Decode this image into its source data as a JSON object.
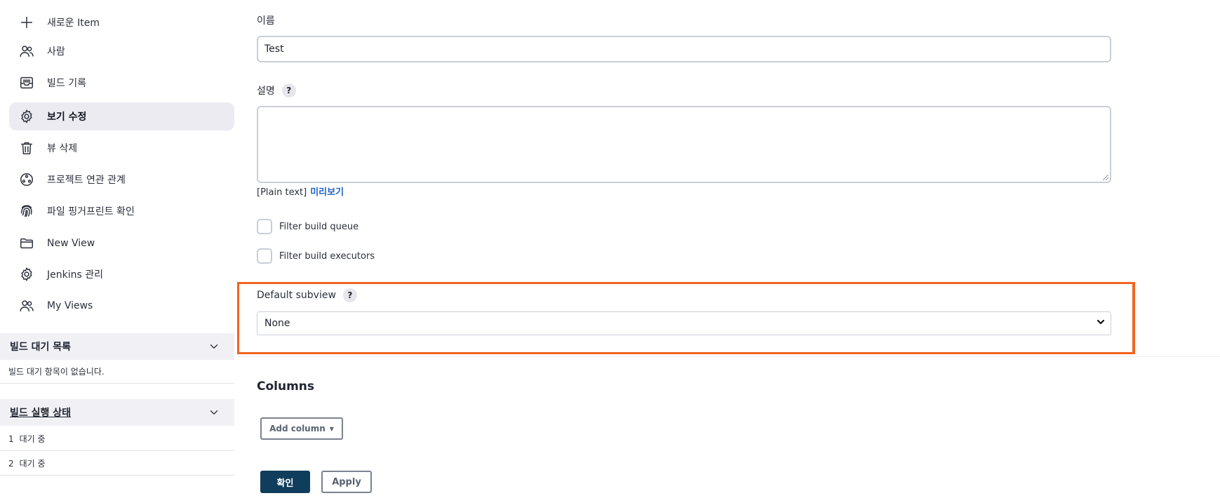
{
  "sidebar": {
    "items": [
      {
        "label": "새로운 Item",
        "icon": "plus-icon"
      },
      {
        "label": "사람",
        "icon": "people-icon"
      },
      {
        "label": "빌드 기록",
        "icon": "inbox-icon"
      },
      {
        "label": "보기 수정",
        "icon": "gear-icon",
        "active": true
      },
      {
        "label": "뷰 삭제",
        "icon": "trash-icon"
      },
      {
        "label": "프로젝트 연관 관계",
        "icon": "relationship-icon"
      },
      {
        "label": "파일 핑거프린트 확인",
        "icon": "fingerprint-icon"
      },
      {
        "label": "New View",
        "icon": "folder-icon"
      },
      {
        "label": "Jenkins 관리",
        "icon": "gear-icon"
      },
      {
        "label": "My Views",
        "icon": "people-icon"
      }
    ]
  },
  "build_queue": {
    "title": "빌드 대기 목록",
    "empty_text": "빌드 대기 항목이 없습니다."
  },
  "executor_status": {
    "title": "빌드 실행 상태",
    "rows": [
      {
        "num": "1",
        "text": "대기 중"
      },
      {
        "num": "2",
        "text": "대기 중"
      }
    ]
  },
  "form": {
    "name_label": "이름",
    "name_value": "Test",
    "description_label": "설명",
    "help_glyph": "?",
    "format_text": "[Plain text]",
    "preview_link": "미리보기",
    "filter_queue_label": "Filter build queue",
    "filter_executors_label": "Filter build executors",
    "default_subview_label": "Default subview",
    "default_subview_value": "None",
    "columns_title": "Columns",
    "add_column_label": "Add column",
    "save_label": "확인",
    "apply_label": "Apply"
  },
  "colors": {
    "highlight": "#f26522",
    "primary_button": "#113d5c",
    "link": "#1e63c8",
    "active_item_bg": "#ebebf1"
  }
}
